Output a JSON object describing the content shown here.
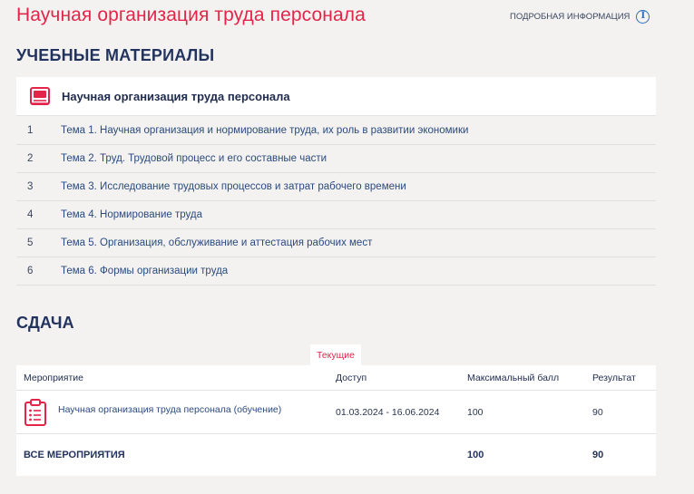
{
  "header": {
    "course_title": "Научная организация труда персонала",
    "more_info_label": "ПОДРОБНАЯ ИНФОРМАЦИЯ",
    "info_icon_glyph": "i"
  },
  "materials": {
    "heading": "УЧЕБНЫЕ МАТЕРИАЛЫ",
    "card_title": "Научная организация труда персонала",
    "topics": [
      {
        "num": "1",
        "title": "Тема 1. Научная организация и нормирование труда, их роль в развитии экономики"
      },
      {
        "num": "2",
        "title": "Тема 2. Труд. Трудовой процесс и его составные части"
      },
      {
        "num": "3",
        "title": "Тема 3. Исследование трудовых процессов и затрат рабочего времени"
      },
      {
        "num": "4",
        "title": "Тема 4. Нормирование труда"
      },
      {
        "num": "5",
        "title": "Тема 5. Организация, обслуживание и аттестация рабочих мест"
      },
      {
        "num": "6",
        "title": "Тема 6. Формы организации труда"
      }
    ]
  },
  "submission": {
    "heading": "СДАЧА",
    "tab_current": "Текущие",
    "columns": {
      "event": "Мероприятие",
      "access": "Доступ",
      "max_score": "Максимальный балл",
      "result": "Результат"
    },
    "rows": [
      {
        "event": "Научная организация труда персонала (обучение)",
        "access": "01.03.2024 - 16.06.2024",
        "max_score": "100",
        "result": "90"
      }
    ],
    "total": {
      "label": "ВСЕ МЕРОПРИЯТИЯ",
      "max_score": "100",
      "result": "90"
    }
  },
  "colors": {
    "accent": "#e3254a",
    "heading": "#22335e",
    "link": "#2a4a7e",
    "info_icon": "#2f6fc1",
    "background": "#f3f2f0"
  },
  "icons": {
    "card": "book-icon",
    "event": "clipboard-icon",
    "info": "info-icon"
  }
}
